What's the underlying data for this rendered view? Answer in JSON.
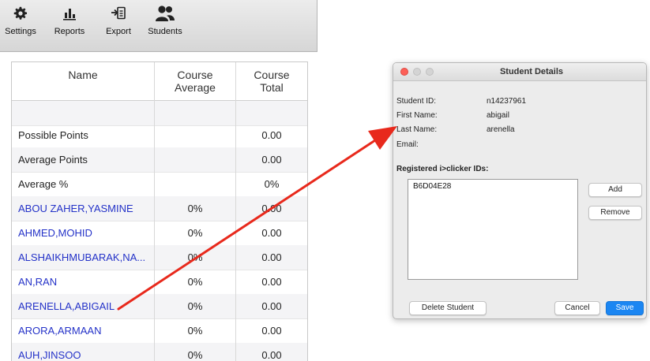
{
  "toolbar": {
    "items": [
      {
        "label": "Settings",
        "icon": "gear-icon"
      },
      {
        "label": "Reports",
        "icon": "bar-chart-icon"
      },
      {
        "label": "Export",
        "icon": "export-icon"
      },
      {
        "label": "Students",
        "icon": "people-icon"
      }
    ]
  },
  "table": {
    "headers": {
      "name": "Name",
      "avg_line1": "Course",
      "avg_line2": "Average",
      "total_line1": "Course",
      "total_line2": "Total"
    },
    "summary_rows": [
      {
        "name": "",
        "average": "",
        "total": ""
      },
      {
        "name": "Possible Points",
        "average": "",
        "total": "0.00"
      },
      {
        "name": "Average Points",
        "average": "",
        "total": "0.00"
      },
      {
        "name": "Average %",
        "average": "",
        "total": "0%"
      }
    ],
    "student_rows": [
      {
        "name": "ABOU ZAHER,YASMINE",
        "average": "0%",
        "total": "0.00"
      },
      {
        "name": "AHMED,MOHID",
        "average": "0%",
        "total": "0.00"
      },
      {
        "name": "ALSHAIKHMUBARAK,NA...",
        "average": "0%",
        "total": "0.00"
      },
      {
        "name": "AN,RAN",
        "average": "0%",
        "total": "0.00"
      },
      {
        "name": "ARENELLA,ABIGAIL",
        "average": "0%",
        "total": "0.00"
      },
      {
        "name": "ARORA,ARMAAN",
        "average": "0%",
        "total": "0.00"
      },
      {
        "name": "AUH,JINSOO",
        "average": "0%",
        "total": "0.00"
      }
    ]
  },
  "dialog": {
    "title": "Student Details",
    "fields": [
      {
        "label": "Student ID:",
        "value": "n14237961"
      },
      {
        "label": "First Name:",
        "value": "abigail"
      },
      {
        "label": "Last Name:",
        "value": "arenella"
      },
      {
        "label": "Email:",
        "value": ""
      }
    ],
    "registered_label": "Registered i>clicker IDs:",
    "clicker_ids": [
      "B6D04E28"
    ],
    "buttons": {
      "add": "Add",
      "remove": "Remove",
      "delete": "Delete Student",
      "cancel": "Cancel",
      "save": "Save"
    }
  },
  "colors": {
    "link": "#2432c8",
    "arrow": "#e8291c",
    "primary_button": "#1b86f2"
  }
}
